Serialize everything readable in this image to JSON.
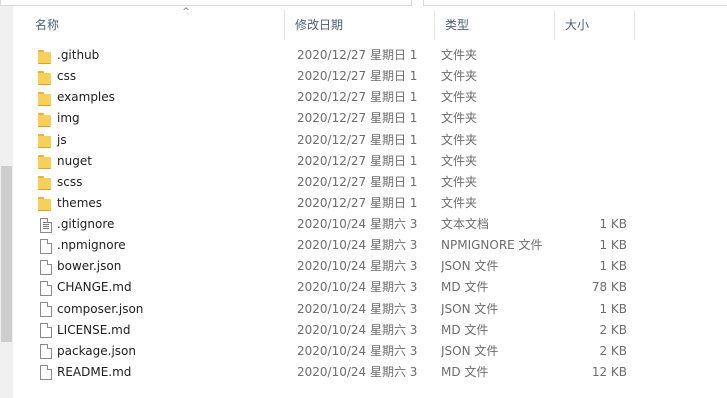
{
  "header": {
    "name": "名称",
    "date": "修改日期",
    "type": "类型",
    "size": "大小",
    "sort_indicator": "^"
  },
  "files": [
    {
      "name": ".github",
      "date": "2020/12/27 星期日 1...",
      "type": "文件夹",
      "size": "",
      "icon": "folder-icon"
    },
    {
      "name": "css",
      "date": "2020/12/27 星期日 1...",
      "type": "文件夹",
      "size": "",
      "icon": "folder-icon"
    },
    {
      "name": "examples",
      "date": "2020/12/27 星期日 1...",
      "type": "文件夹",
      "size": "",
      "icon": "folder-icon"
    },
    {
      "name": "img",
      "date": "2020/12/27 星期日 1...",
      "type": "文件夹",
      "size": "",
      "icon": "folder-icon"
    },
    {
      "name": "js",
      "date": "2020/12/27 星期日 1...",
      "type": "文件夹",
      "size": "",
      "icon": "folder-icon"
    },
    {
      "name": "nuget",
      "date": "2020/12/27 星期日 1...",
      "type": "文件夹",
      "size": "",
      "icon": "folder-icon"
    },
    {
      "name": "scss",
      "date": "2020/12/27 星期日 1...",
      "type": "文件夹",
      "size": "",
      "icon": "folder-icon"
    },
    {
      "name": "themes",
      "date": "2020/12/27 星期日 1...",
      "type": "文件夹",
      "size": "",
      "icon": "folder-icon"
    },
    {
      "name": ".gitignore",
      "date": "2020/10/24 星期六 3:...",
      "type": "文本文档",
      "size": "1 KB",
      "icon": "text-file-icon"
    },
    {
      "name": ".npmignore",
      "date": "2020/10/24 星期六 3:...",
      "type": "NPMIGNORE 文件",
      "size": "1 KB",
      "icon": "file-icon"
    },
    {
      "name": "bower.json",
      "date": "2020/10/24 星期六 3:...",
      "type": "JSON 文件",
      "size": "1 KB",
      "icon": "file-icon"
    },
    {
      "name": "CHANGE.md",
      "date": "2020/10/24 星期六 3:...",
      "type": "MD 文件",
      "size": "78 KB",
      "icon": "file-icon"
    },
    {
      "name": "composer.json",
      "date": "2020/10/24 星期六 3:...",
      "type": "JSON 文件",
      "size": "1 KB",
      "icon": "file-icon"
    },
    {
      "name": "LICENSE.md",
      "date": "2020/10/24 星期六 3:...",
      "type": "MD 文件",
      "size": "2 KB",
      "icon": "file-icon"
    },
    {
      "name": "package.json",
      "date": "2020/10/24 星期六 3:...",
      "type": "JSON 文件",
      "size": "2 KB",
      "icon": "file-icon"
    },
    {
      "name": "README.md",
      "date": "2020/10/24 星期六 3:...",
      "type": "MD 文件",
      "size": "12 KB",
      "icon": "file-icon"
    }
  ]
}
